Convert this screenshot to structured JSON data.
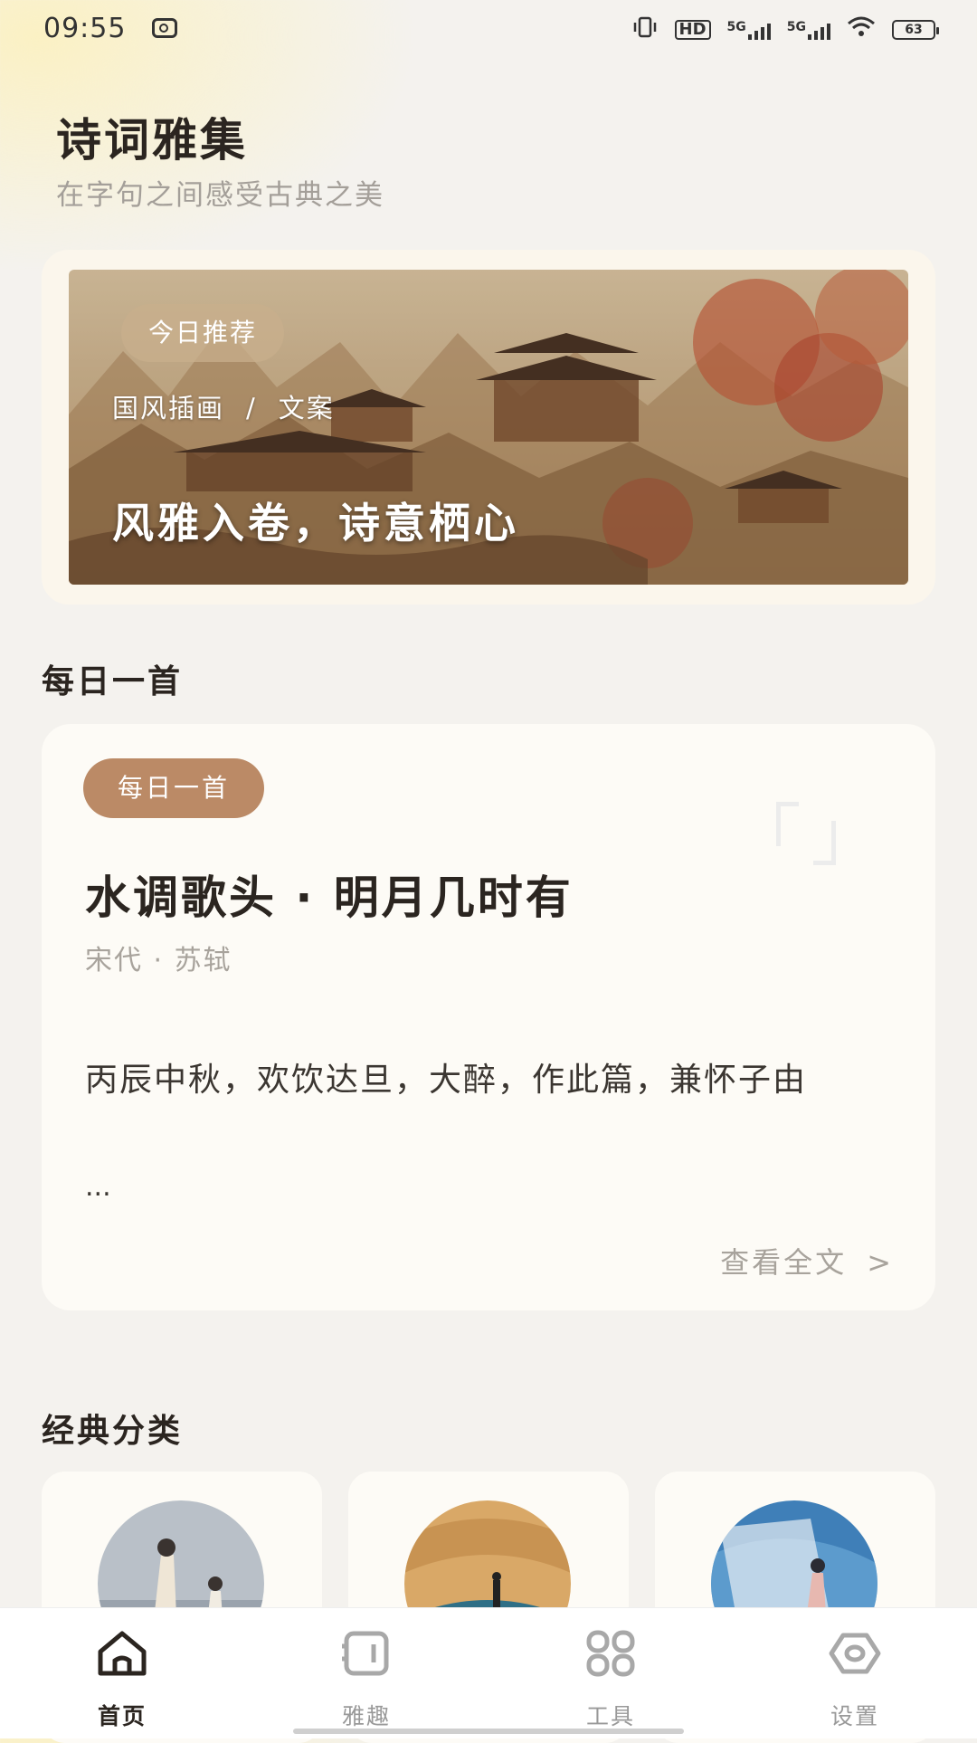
{
  "status_bar": {
    "time": "09:55",
    "network_1": "5G",
    "network_2": "5G",
    "hd_label": "HD",
    "battery": "63"
  },
  "header": {
    "title": "诗词雅集",
    "subtitle": "在字句之间感受古典之美"
  },
  "banner": {
    "tag": "今日推荐",
    "crumb_1": "国风插画",
    "crumb_sep": "/",
    "crumb_2": "文案",
    "slogan": "风雅入卷，诗意栖心"
  },
  "daily": {
    "section_title": "每日一首",
    "tag": "每日一首",
    "title": "水调歌头 · 明月几时有",
    "author": "宋代 · 苏轼",
    "excerpt": "丙辰中秋，欢饮达旦，大醉，作此篇，兼怀子由",
    "ellipsis": "...",
    "more_label": "查看全文",
    "more_chevron": ">"
  },
  "categories": {
    "section_title": "经典分类"
  },
  "tabbar": {
    "items": [
      {
        "label": "首页",
        "icon": "home-icon",
        "active": true
      },
      {
        "label": "雅趣",
        "icon": "book-icon",
        "active": false
      },
      {
        "label": "工具",
        "icon": "grid-icon",
        "active": false
      },
      {
        "label": "设置",
        "icon": "eye-settings-icon",
        "active": false
      }
    ]
  },
  "colors": {
    "accent_tag": "#bb8a66",
    "background": "#f4f2ee",
    "card": "#fdfbf6"
  }
}
